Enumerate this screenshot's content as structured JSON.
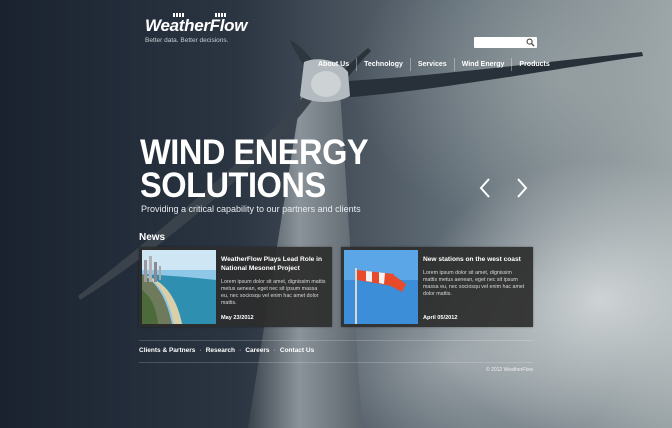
{
  "brand": {
    "name": "WeatherFlow",
    "tagline": "Better data. Better decisions."
  },
  "search": {
    "placeholder": "",
    "icon": "search-icon"
  },
  "nav": {
    "items": [
      {
        "label": "About Us"
      },
      {
        "label": "Technology"
      },
      {
        "label": "Services"
      },
      {
        "label": "Wind Energy"
      },
      {
        "label": "Products"
      }
    ]
  },
  "hero": {
    "title_line1": "WIND ENERGY",
    "title_line2": "SOLUTIONS",
    "subtitle": "Providing a critical capability to our partners and clients"
  },
  "slider": {
    "prev_icon": "chevron-left-icon",
    "next_icon": "chevron-right-icon"
  },
  "news": {
    "heading": "News",
    "items": [
      {
        "title": "WeatherFlow Plays Lead Role in National Mesonet Project",
        "text": "Lorem ipsum dolor sit amet, dignissim mattis metus aenean, eget nec sit ipsum massa eu, nec sociosqu vel enim hac amet dolor mattis.",
        "date": "May 23/2012"
      },
      {
        "title": "New stations on the west coast",
        "text": "Lorem ipsum dolor sit amet, dignissim mattis metus aenean, eget nec sit ipsum massa eu, nec sociosqu vel enim hac amet dolor mattis.",
        "date": "April 05/2012"
      }
    ]
  },
  "footer": {
    "links": [
      {
        "label": "Clients & Partners"
      },
      {
        "label": "Research"
      },
      {
        "label": "Careers"
      },
      {
        "label": "Contact Us"
      }
    ],
    "separator": "·",
    "copyright": "© 2012 WeatherFlow"
  }
}
